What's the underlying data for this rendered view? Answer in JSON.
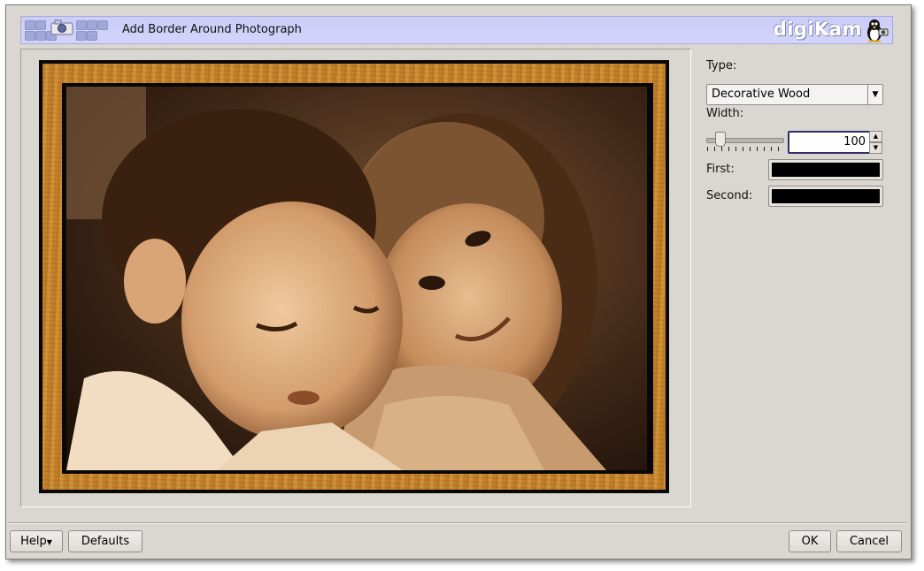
{
  "header": {
    "title": "Add Border Around Photograph",
    "app_logo_text": "digiKam"
  },
  "settings": {
    "type_label": "Type:",
    "type_value": "Decorative Wood",
    "width_label": "Width:",
    "width_value": "100",
    "first_label": "First:",
    "second_label": "Second:",
    "first_color": "#000000",
    "second_color": "#000000"
  },
  "buttons": {
    "help_label": "Help",
    "defaults_label": "Defaults",
    "ok_label": "OK",
    "cancel_label": "Cancel"
  },
  "icons": [
    "digikam-banner-icons",
    "penguin-camera-logo",
    "combo-arrow-icon",
    "spin-up-icon",
    "spin-down-icon",
    "help-dropdown-icon"
  ],
  "colors": {
    "dialog_background": "#dad7d2",
    "banner_background": "#cbcdf6",
    "wood_border": "#c98a2e"
  }
}
